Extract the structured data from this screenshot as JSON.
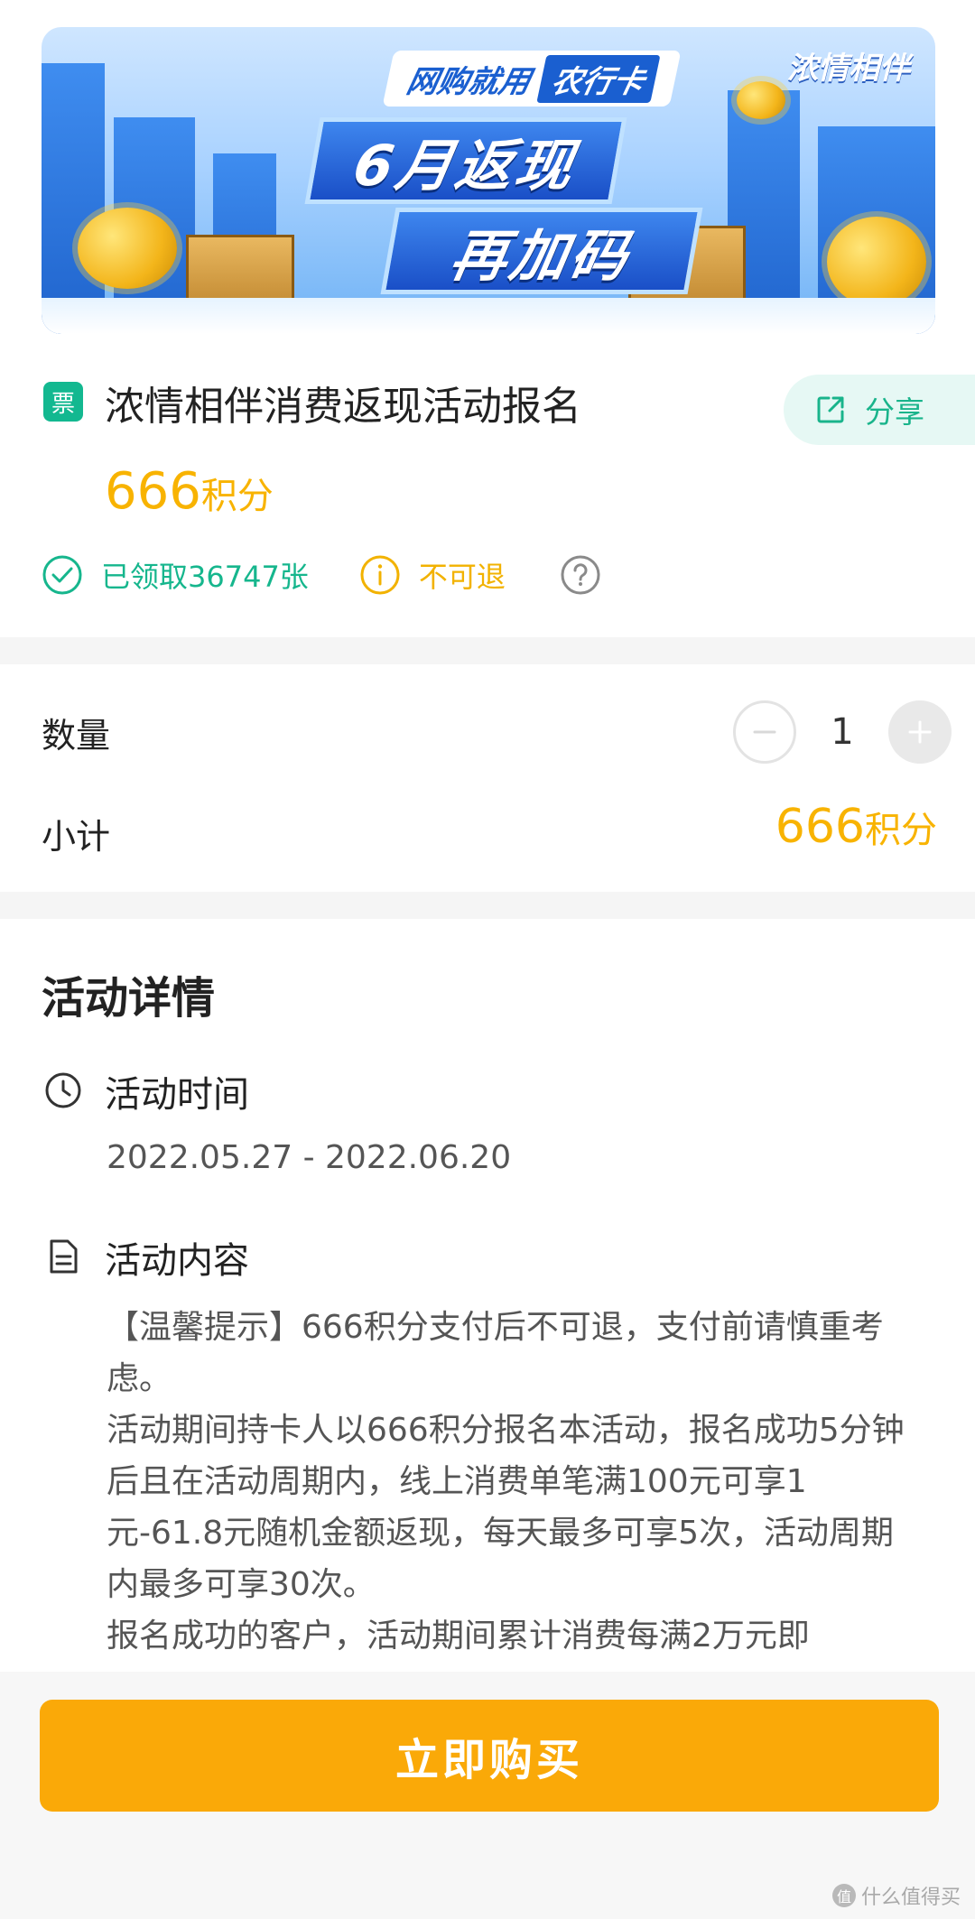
{
  "banner": {
    "tag_text": "网购就用",
    "tag_chip": "农行卡",
    "headline_1": "6月返现",
    "headline_2": "再加码",
    "logo_text": "浓情相伴"
  },
  "product": {
    "ticket_icon_text": "票",
    "title": "浓情相伴消费返现活动报名",
    "share_label": "分享",
    "price_value": "666",
    "price_unit": "积分"
  },
  "badges": {
    "claimed": "已领取36747张",
    "no_refund": "不可退"
  },
  "purchase": {
    "quantity_label": "数量",
    "quantity": "1",
    "subtotal_label": "小计",
    "subtotal_value": "666",
    "subtotal_unit": "积分"
  },
  "details": {
    "section_title": "活动详情",
    "time_title": "活动时间",
    "time_range": "2022.05.27 - 2022.06.20",
    "content_title": "活动内容",
    "paragraphs": [
      "【温馨提示】666积分支付后不可退，支付前请慎重考虑。",
      "活动期间持卡人以666积分报名本活动，报名成功5分钟后且在活动周期内，线上消费单笔满100元可享1元-61.8元随机金额返现，每天最多可享5次，活动周期内最多可享30次。",
      "报名成功的客户，活动期间累计消费每满2万元即"
    ]
  },
  "footer": {
    "buy_label": "立即购买",
    "watermark": "什么值得买"
  },
  "colors": {
    "accent_green": "#16b68d",
    "accent_orange": "#f8b300",
    "buy_button": "#faa908"
  },
  "icons": [
    "ticket-icon",
    "share-icon",
    "check-circle-icon",
    "info-icon",
    "help-icon",
    "minus-icon",
    "plus-icon",
    "clock-icon",
    "document-icon"
  ]
}
